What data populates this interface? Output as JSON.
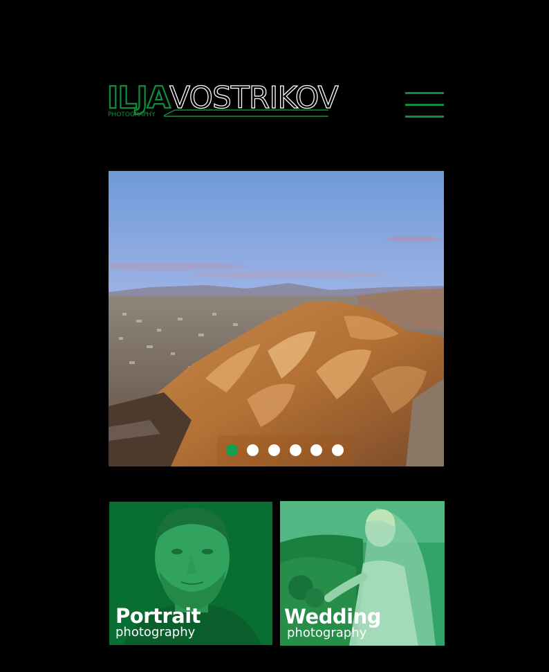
{
  "header": {
    "logo": {
      "first_name": "ILJA",
      "last_name": "VOSTRIKOV",
      "tagline": "PHOTOGRAPHY"
    },
    "menu_icon": "hamburger-menu-icon"
  },
  "slider": {
    "slide_count": 6,
    "active_index": 0,
    "dots": [
      {
        "active": true
      },
      {
        "active": false
      },
      {
        "active": false
      },
      {
        "active": false
      },
      {
        "active": false
      },
      {
        "active": false
      }
    ]
  },
  "categories": [
    {
      "title": "Portrait",
      "subtitle": "photography"
    },
    {
      "title": "Wedding",
      "subtitle": "photography"
    }
  ],
  "colors": {
    "background": "#000000",
    "accent_green": "#0f8f3c",
    "active_dot": "#11a052",
    "inactive_dot": "#ffffff"
  }
}
